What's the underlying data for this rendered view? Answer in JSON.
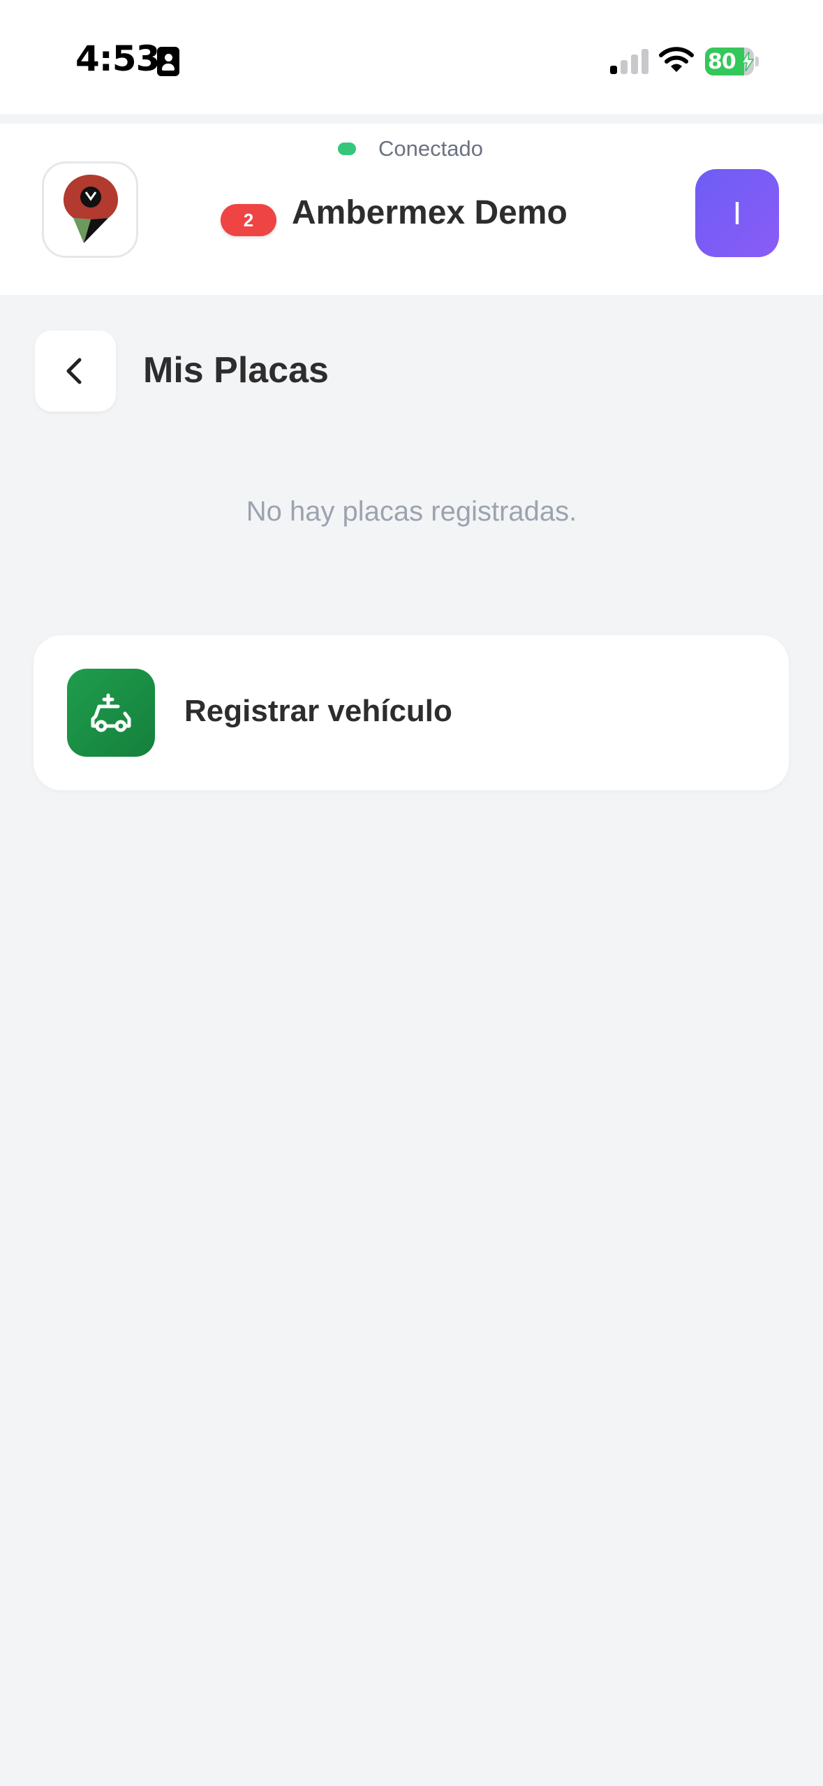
{
  "status_bar": {
    "time": "4:53",
    "battery_level": "80",
    "battery_percent": 80,
    "signal_bars": 1,
    "icons": [
      "id-card-icon",
      "cellular-signal-icon",
      "wifi-icon",
      "battery-charging-icon"
    ]
  },
  "header": {
    "connection_status": "Conectado",
    "org_name": "Ambermex Demo",
    "notification_count": "2",
    "avatar_initial": "I",
    "logo_icon": "map-pin-logo-icon"
  },
  "page": {
    "title": "Mis Placas",
    "back_icon": "chevron-left-icon",
    "empty_message": "No hay placas registradas."
  },
  "actions": {
    "register_vehicle_label": "Registrar vehículo",
    "register_vehicle_icon": "car-add-icon"
  },
  "colors": {
    "background": "#f3f4f6",
    "connected": "#34c77b",
    "badge": "#ef4444",
    "avatar": "#7c5cf6",
    "register_icon_bg": "#1a8f45",
    "battery": "#34c759"
  }
}
